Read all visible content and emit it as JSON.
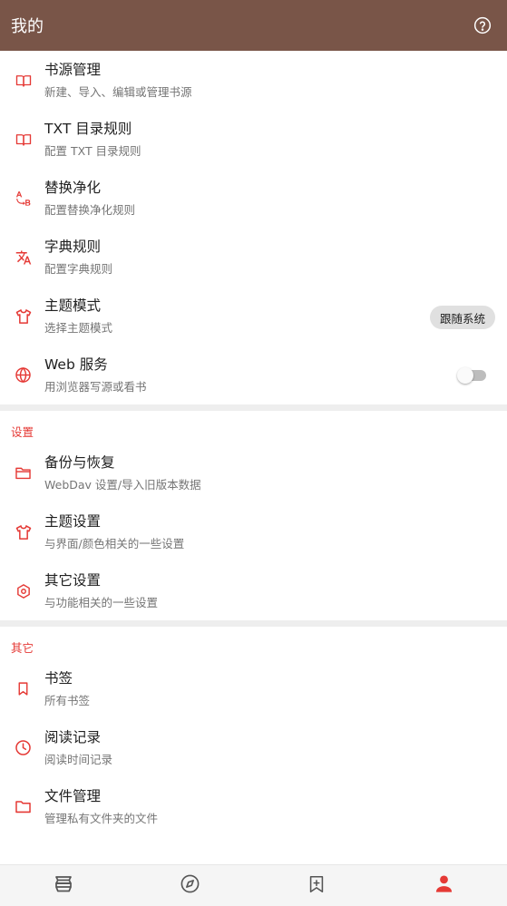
{
  "appbar": {
    "title": "我的",
    "help_icon": "help-circle-icon"
  },
  "colors": {
    "appbar": "#795548",
    "accent": "#e53935",
    "icon": "#e53935"
  },
  "main_items": [
    {
      "title": "书源管理",
      "subtitle": "新建、导入、编辑或管理书源",
      "icon": "book-open-icon"
    },
    {
      "title": "TXT 目录规则",
      "subtitle": "配置 TXT 目录规则",
      "icon": "book-open-icon"
    },
    {
      "title": "替换净化",
      "subtitle": "配置替换净化规则",
      "icon": "find-replace-icon"
    },
    {
      "title": "字典规则",
      "subtitle": "配置字典规则",
      "icon": "translate-icon"
    },
    {
      "title": "主题模式",
      "subtitle": "选择主题模式",
      "icon": "tshirt-icon",
      "value": "跟随系统"
    },
    {
      "title": "Web 服务",
      "subtitle": "用浏览器写源或看书",
      "icon": "globe-icon",
      "switch_on": false
    }
  ],
  "settings_section": {
    "header": "设置",
    "items": [
      {
        "title": "备份与恢复",
        "subtitle": "WebDav 设置/导入旧版本数据",
        "icon": "folder-open-icon"
      },
      {
        "title": "主题设置",
        "subtitle": "与界面/颜色相关的一些设置",
        "icon": "tshirt-icon"
      },
      {
        "title": "其它设置",
        "subtitle": "与功能相关的一些设置",
        "icon": "settings-hex-icon"
      }
    ]
  },
  "other_section": {
    "header": "其它",
    "items": [
      {
        "title": "书签",
        "subtitle": "所有书签",
        "icon": "bookmark-icon"
      },
      {
        "title": "阅读记录",
        "subtitle": "阅读时间记录",
        "icon": "clock-icon"
      },
      {
        "title": "文件管理",
        "subtitle": "管理私有文件夹的文件",
        "icon": "folder-icon"
      }
    ]
  },
  "bottom_nav": [
    {
      "icon": "bookshelf-icon",
      "active": false
    },
    {
      "icon": "compass-icon",
      "active": false
    },
    {
      "icon": "bookmark-plus-icon",
      "active": false
    },
    {
      "icon": "person-icon",
      "active": true
    }
  ]
}
